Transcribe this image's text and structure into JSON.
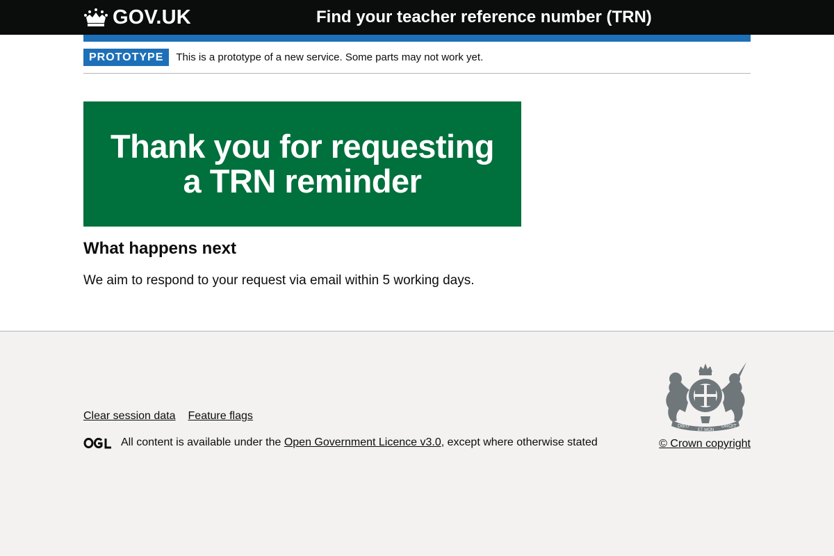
{
  "header": {
    "logo_text": "GOV.UK",
    "service_name": "Find your teacher reference number (TRN)"
  },
  "phase_banner": {
    "tag": "PROTOTYPE",
    "text": "This is a prototype of a new service. Some parts may not work yet."
  },
  "main": {
    "panel_title": "Thank you for requesting a TRN reminder",
    "next_heading": "What happens next",
    "next_body": "We aim to respond to your request via email within 5 working days."
  },
  "footer": {
    "links": [
      "Clear session data",
      "Feature flags"
    ],
    "licence_prefix": "All content is available under the",
    "licence_link": "Open Government Licence v3.0",
    "licence_suffix": ", except where otherwise stated",
    "copyright": "© Crown copyright",
    "crest_text": [
      "DIEU",
      "ET MON",
      "DROIT"
    ]
  },
  "colors": {
    "header_bg": "#0b0c0c",
    "brand_blue": "#1d70b8",
    "panel_green": "#00703c",
    "footer_bg": "#f3f2f1"
  },
  "icons": {
    "logo": "crown-icon",
    "licence": "ogl-logo-icon",
    "crest": "royal-coat-of-arms"
  }
}
